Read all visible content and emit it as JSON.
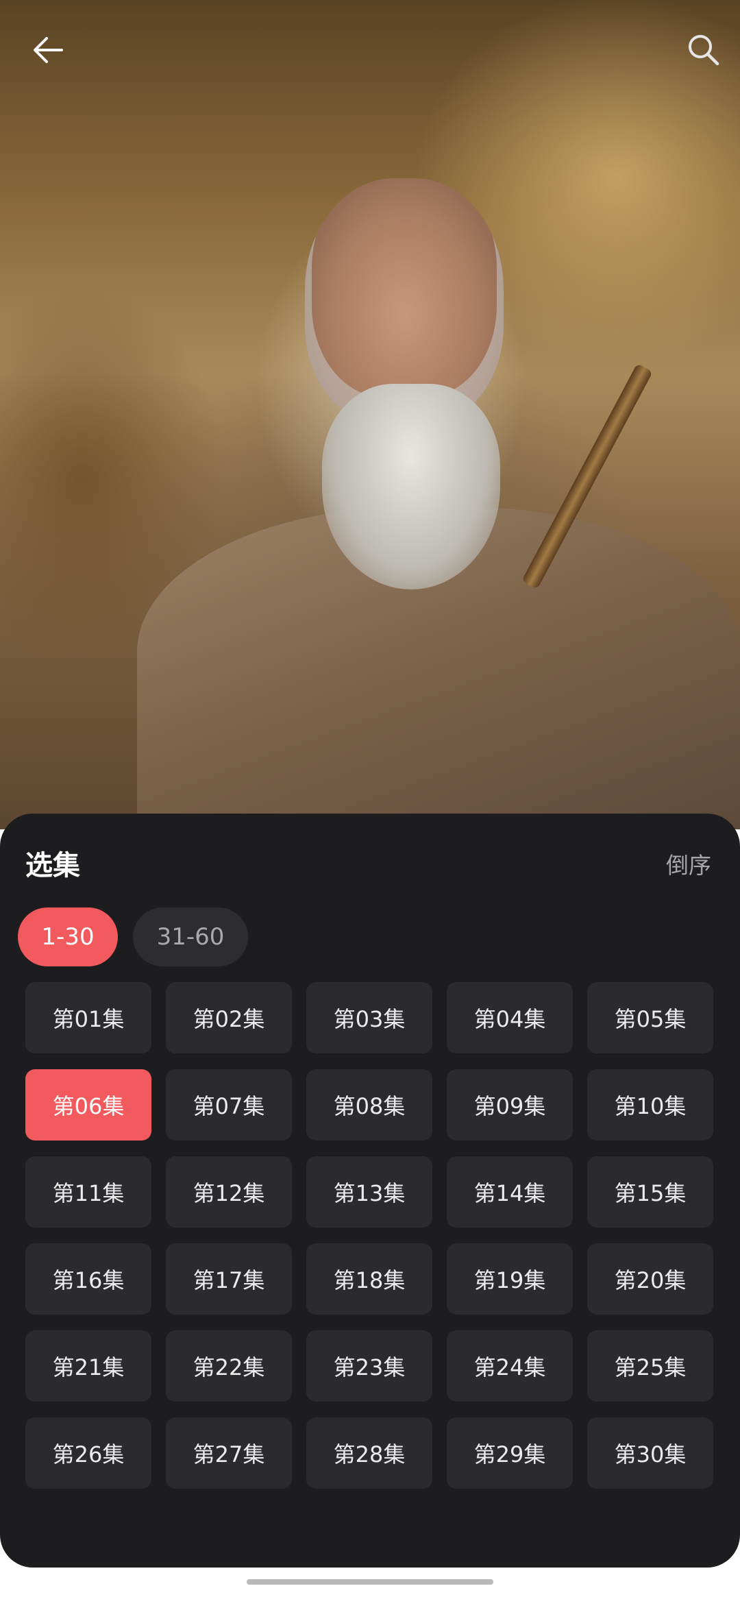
{
  "header": {
    "back_icon": "arrow-left-icon",
    "search_icon": "search-icon"
  },
  "sheet": {
    "title": "选集",
    "order_label": "倒序",
    "ranges": [
      {
        "label": "1-30",
        "selected": true
      },
      {
        "label": "31-60",
        "selected": false
      }
    ],
    "selected_episode": "第06集",
    "episodes": [
      "第01集",
      "第02集",
      "第03集",
      "第04集",
      "第05集",
      "第06集",
      "第07集",
      "第08集",
      "第09集",
      "第10集",
      "第11集",
      "第12集",
      "第13集",
      "第14集",
      "第15集",
      "第16集",
      "第17集",
      "第18集",
      "第19集",
      "第20集",
      "第21集",
      "第22集",
      "第23集",
      "第24集",
      "第25集",
      "第26集",
      "第27集",
      "第28集",
      "第29集",
      "第30集"
    ]
  },
  "colors": {
    "accent": "#f35a5d",
    "sheet_bg": "#1d1d20",
    "chip_bg": "#2b2b2f"
  }
}
